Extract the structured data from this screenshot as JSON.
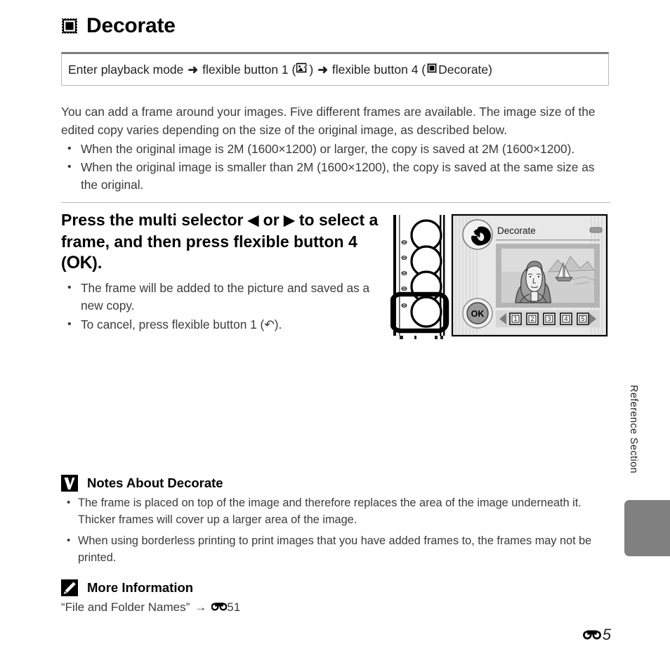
{
  "page": {
    "title": "Decorate",
    "title_icon": "decorate-frame-icon",
    "side_label": "Reference Section",
    "page_number": "5",
    "page_number_prefix_icon": "reference-section-e-icon"
  },
  "path_box": {
    "segment1": "Enter playback mode",
    "arrow1": "➜",
    "segment2": "flexible button 1 (",
    "icon1": "retouch-image-icon",
    "segment3": ")",
    "arrow2": "➜",
    "segment4": "flexible button 4 (",
    "icon2": "decorate-frame-icon",
    "segment5": " Decorate)"
  },
  "intro": {
    "paragraph": "You can add a frame around your images. Five different frames are available. The image size of the edited copy varies depending on the size of the original image, as described below.",
    "bullets": [
      "When the original image is 2M (1600×1200) or larger, the copy is saved at 2M (1600×1200).",
      "When the original image is smaller than 2M (1600×1200), the copy is saved at the same size as the original."
    ]
  },
  "step": {
    "heading_part1": "Press the multi selector ",
    "left_triangle": "◀",
    "heading_part2": " or ",
    "right_triangle": "▶",
    "heading_part3": " to select a frame, and then press flexible button 4 (",
    "ok_glyph": "OK",
    "heading_part4": ").",
    "bullets": [
      "The frame will be added to the picture and saved as a new copy.",
      "To cancel, press flexible button 1 (↶)."
    ]
  },
  "camera": {
    "screen_title": "Decorate",
    "back_button_label": "back-arrow",
    "ok_button_label": "OK",
    "battery_icon": "battery-icon",
    "frame_options": [
      "1",
      "2",
      "3",
      "4",
      "5"
    ],
    "selected_frame": "1",
    "left_arrow": "◀",
    "right_arrow": "▶",
    "highlighted_button": "flexible-button-4",
    "buttons_count": 4,
    "colors": {
      "screen_bg": "#e3e3e3",
      "photo_bg": "#b3b3b3",
      "ok_fill": "#9a9a9a",
      "body_outline": "#000000"
    }
  },
  "notes": {
    "icon": "warning-check-icon",
    "title": "Notes About Decorate",
    "bullets": [
      "The frame is placed on top of the image and therefore replaces the area of the image underneath it. Thicker frames will cover up a larger area of the image.",
      "When using borderless printing to print images that you have added frames to, the frames may not be printed."
    ]
  },
  "more_info": {
    "icon": "pencil-note-icon",
    "title": "More Information",
    "reference_text": "“File and Folder Names”",
    "arrow": "→",
    "reference_icon": "reference-section-e-icon",
    "reference_page": "51"
  }
}
